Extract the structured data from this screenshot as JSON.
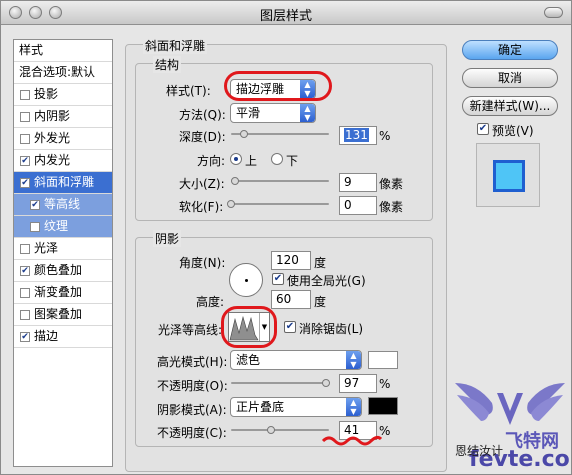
{
  "window": {
    "title": "图层样式"
  },
  "style_list": {
    "header": "样式",
    "items": [
      {
        "label": "混合选项:默认",
        "kind": "plain"
      },
      {
        "label": "投影",
        "checked": false
      },
      {
        "label": "内阴影",
        "checked": false
      },
      {
        "label": "外发光",
        "checked": false
      },
      {
        "label": "内发光",
        "checked": true
      },
      {
        "label": "斜面和浮雕",
        "checked": true,
        "selected": true
      },
      {
        "label": "等高线",
        "checked": true,
        "sub": true
      },
      {
        "label": "纹理",
        "checked": false,
        "sub": true
      },
      {
        "label": "光泽",
        "checked": false
      },
      {
        "label": "颜色叠加",
        "checked": true
      },
      {
        "label": "渐变叠加",
        "checked": false
      },
      {
        "label": "图案叠加",
        "checked": false
      },
      {
        "label": "描边",
        "checked": true
      }
    ]
  },
  "bevel": {
    "section_title": "斜面和浮雕",
    "structure": {
      "title": "结构",
      "style_label": "样式(T):",
      "style_value": "描边浮雕",
      "technique_label": "方法(Q):",
      "technique_value": "平滑",
      "depth_label": "深度(D):",
      "depth_value": "131",
      "depth_unit": "%",
      "depth_level": 0.13,
      "direction_label": "方向:",
      "direction_up": "上",
      "direction_down": "下",
      "direction_selected": "上",
      "size_label": "大小(Z):",
      "size_value": "9",
      "size_unit": "像素",
      "size_level": 0.04,
      "soften_label": "软化(F):",
      "soften_value": "0",
      "soften_unit": "像素",
      "soften_level": 0.0
    },
    "shading": {
      "title": "阴影",
      "angle_label": "角度(N):",
      "angle_value": "120",
      "angle_unit": "度",
      "global_light_label": "使用全局光(G)",
      "global_light_checked": true,
      "altitude_label": "高度:",
      "altitude_value": "60",
      "altitude_unit": "度",
      "gloss_contour_label": "光泽等高线:",
      "antialias_label": "消除锯齿(L)",
      "antialias_checked": true,
      "highlight_mode_label": "高光模式(H):",
      "highlight_mode_value": "滤色",
      "highlight_color": "#ffffff",
      "highlight_opacity_label": "不透明度(O):",
      "highlight_opacity_value": "97",
      "highlight_opacity_unit": "%",
      "highlight_opacity_level": 0.97,
      "shadow_mode_label": "阴影模式(A):",
      "shadow_mode_value": "正片叠底",
      "shadow_color": "#000000",
      "shadow_opacity_label": "不透明度(C):",
      "shadow_opacity_value": "41",
      "shadow_opacity_unit": "%",
      "shadow_opacity_level": 0.41
    }
  },
  "buttons": {
    "ok": "确定",
    "cancel": "取消",
    "new_style": "新建样式(W)...",
    "preview_label": "预览(V)",
    "preview_checked": true
  },
  "bottom_partial": "恩结汝计",
  "watermark": {
    "text1": "飞特网",
    "text2": "fevte.com"
  },
  "colors": {
    "accent": "#3b6fd1",
    "annotation_red": "#e0181c",
    "preview_fill": "#4fc5f6",
    "preview_stroke": "#1f5fd0"
  }
}
